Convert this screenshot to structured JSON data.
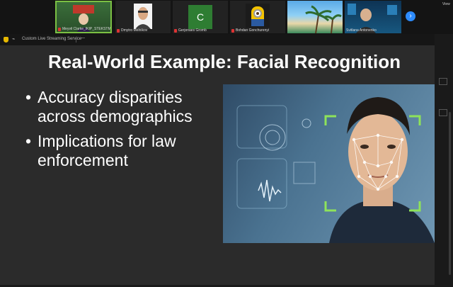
{
  "participants": [
    {
      "name": "Meyvil Clarke_IKIP_STEKSTM",
      "muted": true
    },
    {
      "name": "Dmytro Melnikov",
      "muted": true
    },
    {
      "name": "Gerjonaes Gromb",
      "initial": "C",
      "muted": true
    },
    {
      "name": "Bohdan Gonchurenyi",
      "muted": true
    },
    {
      "name": "",
      "muted": false
    },
    {
      "name": "Svitlana Antonenko",
      "muted": false
    }
  ],
  "top_right_label": "View",
  "session_label": "Custom Live Streaming Service",
  "view_label": "—",
  "slide": {
    "title": "Real-World Example: Facial Recognition",
    "bullets": [
      "Accuracy disparities across demographics",
      "Implications for law enforcement"
    ]
  },
  "colors": {
    "active_speaker": "#7bc043",
    "accent": "#2d8cff",
    "slide_bg": "#2b2b2b"
  }
}
